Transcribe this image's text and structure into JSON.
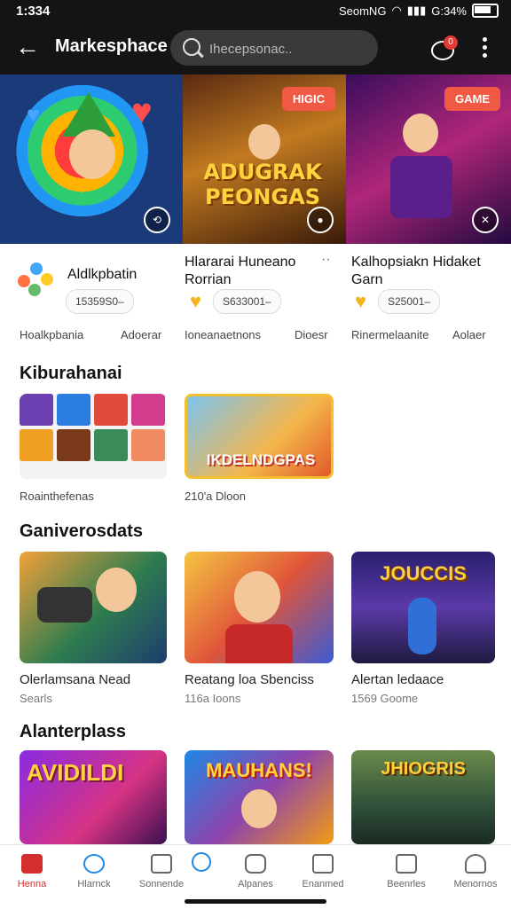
{
  "status_bar": {
    "time": "1:334",
    "right_text": "SeomNG",
    "battery_text": "G:34%"
  },
  "app_bar": {
    "title": "Markesphace",
    "search_placeholder": "Ihecepsonac..",
    "cart_badge": "0"
  },
  "featured": [
    {
      "tag": "",
      "corner": "⟲",
      "name": "Aldlkpbatin",
      "price": "15359S0–"
    },
    {
      "tag": "HIGIC",
      "corner": "●",
      "art_text": "ADUGRAK PEONGAS",
      "name": "Hlararai Huneano Rorrian",
      "price": "S633001–"
    },
    {
      "tag": "GAME",
      "corner": "✕",
      "name": "Kalhopsiakn Hidaket Garn",
      "price": "S25001–"
    }
  ],
  "meta_row": [
    "Hoalkpbania",
    "Adoerar",
    "Ioneanaetnons",
    "Dioesr",
    "Rinermelaanite",
    "Aolaer"
  ],
  "sections": [
    {
      "title": "Kiburahanai",
      "items": [
        {
          "caption": "Roainthefenas"
        },
        {
          "caption": "210'a Dloon",
          "art_text": "IKDELNDGPAS"
        }
      ]
    },
    {
      "title": "Ganiverosdats",
      "items": [
        {
          "caption": "Olerlamsana Nead",
          "sub": "Searls"
        },
        {
          "caption": "Reatang loa Sbenciss",
          "sub": "116a Ioons"
        },
        {
          "caption": "Alertan ledaace",
          "sub": "1569 Goome",
          "art_text": "JOUCCIS"
        }
      ]
    },
    {
      "title": "Alanterplass",
      "items": [
        {
          "art_text": "AVIDILDI"
        },
        {
          "art_text": "MAUHANS!"
        },
        {
          "art_text": "JHIOGRIS"
        }
      ]
    }
  ],
  "bottom_nav": [
    {
      "label": "Henna",
      "icon": "home-icon"
    },
    {
      "label": "Hlarnck",
      "icon": "search-icon"
    },
    {
      "label": "Sonnende",
      "icon": "map-icon"
    },
    {
      "label": "Alpanes",
      "icon": "wallet-icon"
    },
    {
      "label": "Enanmed",
      "icon": "chart-icon"
    },
    {
      "label": "Beenrles",
      "icon": "inbox-icon"
    },
    {
      "label": "Menornos",
      "icon": "profile-icon"
    }
  ],
  "colors": {
    "accent": "#d32f2f",
    "tag": "#f05a45",
    "appbar": "#141414"
  }
}
